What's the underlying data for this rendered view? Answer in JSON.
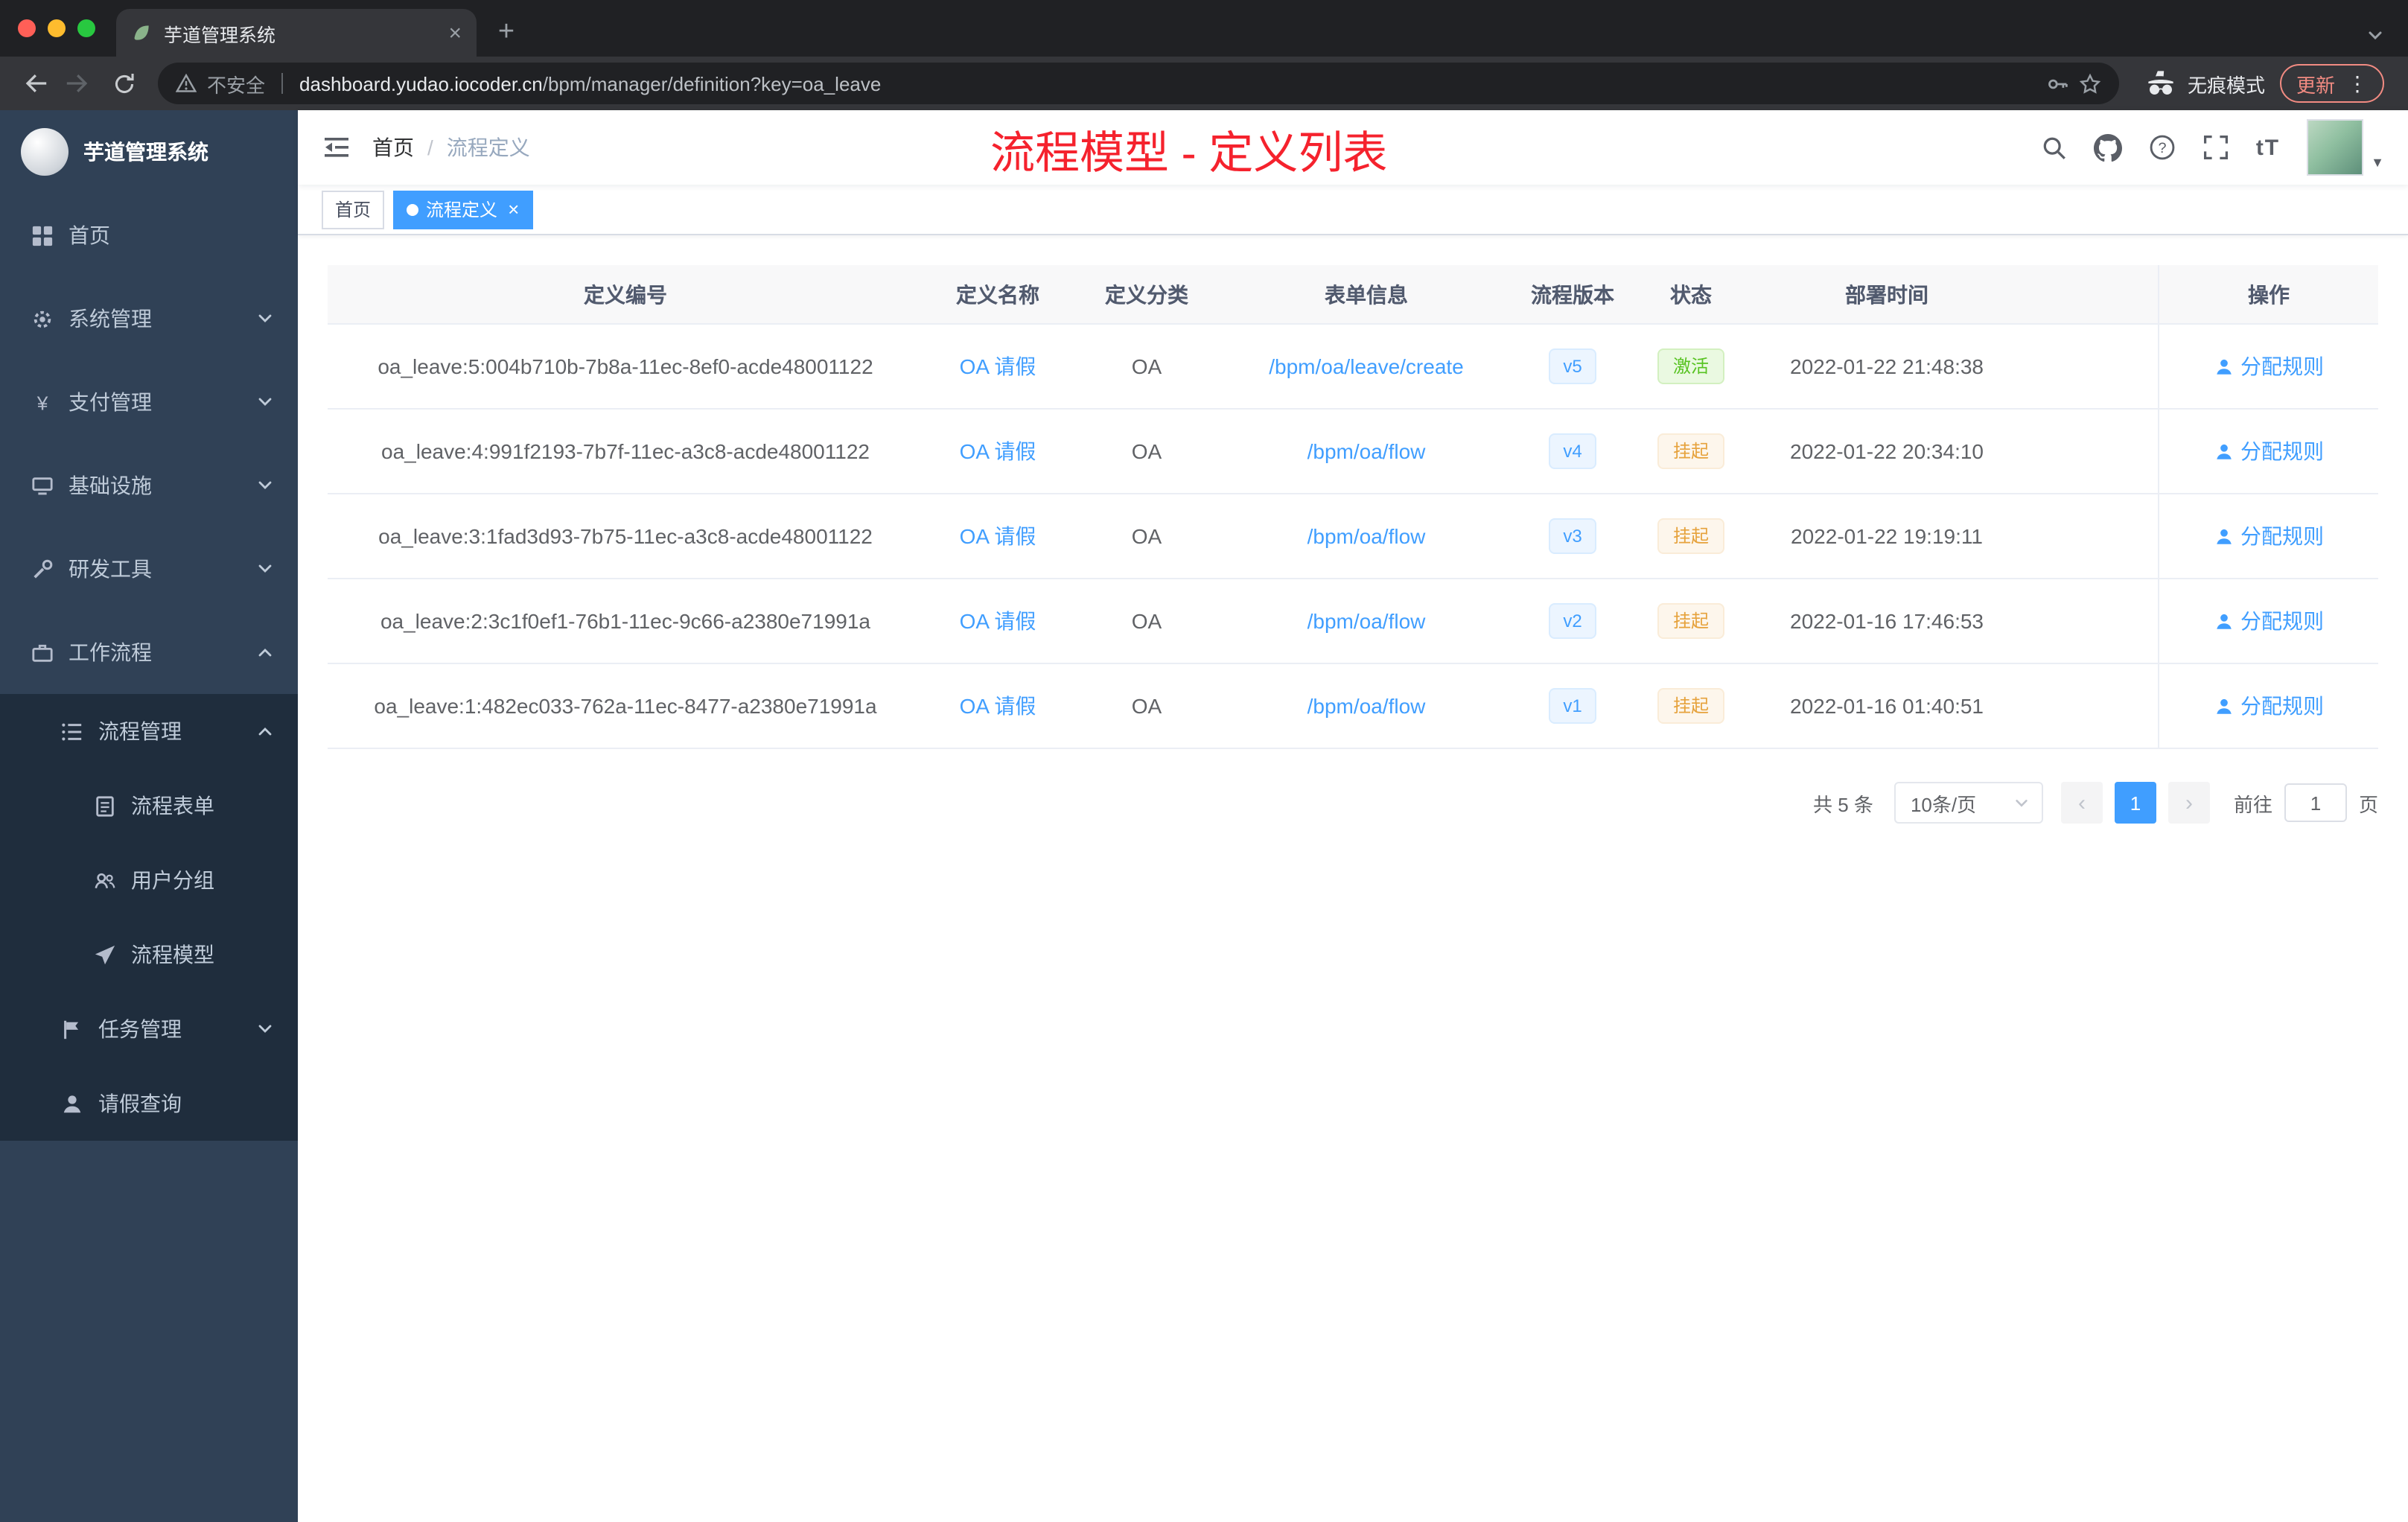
{
  "browser": {
    "tab_title": "芋道管理系统",
    "security_label": "不安全",
    "url_domain": "dashboard.yudao.iocoder.cn",
    "url_path": "/bpm/manager/definition?key=oa_leave",
    "incognito_label": "无痕模式",
    "update_label": "更新"
  },
  "sidebar": {
    "title": "芋道管理系统",
    "items": [
      {
        "key": "home",
        "label": "首页",
        "icon": "dashboard-icon",
        "level": 1
      },
      {
        "key": "system",
        "label": "系统管理",
        "icon": "gear-icon",
        "level": 1,
        "chevron": "down"
      },
      {
        "key": "payment",
        "label": "支付管理",
        "icon": "yen-icon",
        "level": 1,
        "chevron": "down"
      },
      {
        "key": "infrastructure",
        "label": "基础设施",
        "icon": "infra-icon",
        "level": 1,
        "chevron": "down"
      },
      {
        "key": "devtools",
        "label": "研发工具",
        "icon": "tools-icon",
        "level": 1,
        "chevron": "down"
      },
      {
        "key": "workflow",
        "label": "工作流程",
        "icon": "workflow-icon",
        "level": 1,
        "chevron": "up"
      },
      {
        "key": "process-mgmt",
        "label": "流程管理",
        "icon": "process-icon",
        "level": 2,
        "chevron": "up"
      },
      {
        "key": "process-form",
        "label": "流程表单",
        "icon": "form-icon",
        "level": 3
      },
      {
        "key": "user-group",
        "label": "用户分组",
        "icon": "usergroup-icon",
        "level": 3
      },
      {
        "key": "process-model",
        "label": "流程模型",
        "icon": "model-icon",
        "level": 3
      },
      {
        "key": "task-mgmt",
        "label": "任务管理",
        "icon": "task-icon",
        "level": 2,
        "chevron": "down"
      },
      {
        "key": "leave-query",
        "label": "请假查询",
        "icon": "person-icon",
        "level": 2
      }
    ]
  },
  "header": {
    "breadcrumb": {
      "home": "首页",
      "separator": "/",
      "current": "流程定义"
    },
    "annotation": "流程模型 - 定义列表"
  },
  "tags": [
    {
      "key": "home",
      "label": "首页",
      "active": false,
      "closable": false
    },
    {
      "key": "definition",
      "label": "流程定义",
      "active": true,
      "closable": true
    }
  ],
  "table": {
    "headers": [
      "定义编号",
      "定义名称",
      "定义分类",
      "表单信息",
      "流程版本",
      "状态",
      "部署时间",
      "操作"
    ],
    "rows": [
      {
        "id": "oa_leave:5:004b710b-7b8a-11ec-8ef0-acde48001122",
        "name": "OA 请假",
        "category": "OA",
        "form": "/bpm/oa/leave/create",
        "version": "v5",
        "status": "激活",
        "status_type": "success",
        "time": "2022-01-22 21:48:38",
        "action": "分配规则"
      },
      {
        "id": "oa_leave:4:991f2193-7b7f-11ec-a3c8-acde48001122",
        "name": "OA 请假",
        "category": "OA",
        "form": "/bpm/oa/flow",
        "version": "v4",
        "status": "挂起",
        "status_type": "warning",
        "time": "2022-01-22 20:34:10",
        "action": "分配规则"
      },
      {
        "id": "oa_leave:3:1fad3d93-7b75-11ec-a3c8-acde48001122",
        "name": "OA 请假",
        "category": "OA",
        "form": "/bpm/oa/flow",
        "version": "v3",
        "status": "挂起",
        "status_type": "warning",
        "time": "2022-01-22 19:19:11",
        "action": "分配规则"
      },
      {
        "id": "oa_leave:2:3c1f0ef1-76b1-11ec-9c66-a2380e71991a",
        "name": "OA 请假",
        "category": "OA",
        "form": "/bpm/oa/flow",
        "version": "v2",
        "status": "挂起",
        "status_type": "warning",
        "time": "2022-01-16 17:46:53",
        "action": "分配规则"
      },
      {
        "id": "oa_leave:1:482ec033-762a-11ec-8477-a2380e71991a",
        "name": "OA 请假",
        "category": "OA",
        "form": "/bpm/oa/flow",
        "version": "v1",
        "status": "挂起",
        "status_type": "warning",
        "time": "2022-01-16 01:40:51",
        "action": "分配规则"
      }
    ]
  },
  "pagination": {
    "total": "共 5 条",
    "page_size": "10条/页",
    "current_page": "1",
    "prev": "‹",
    "next": "›",
    "goto_label": "前往",
    "goto_value": "1",
    "goto_unit": "页"
  },
  "colors": {
    "accent": "#409eff",
    "annotation_red": "#f5222d",
    "success_text": "#58c322",
    "warning_text": "#e6a23c",
    "sidebar_bg": "#304156",
    "submenu_bg": "#1f2d3d"
  }
}
